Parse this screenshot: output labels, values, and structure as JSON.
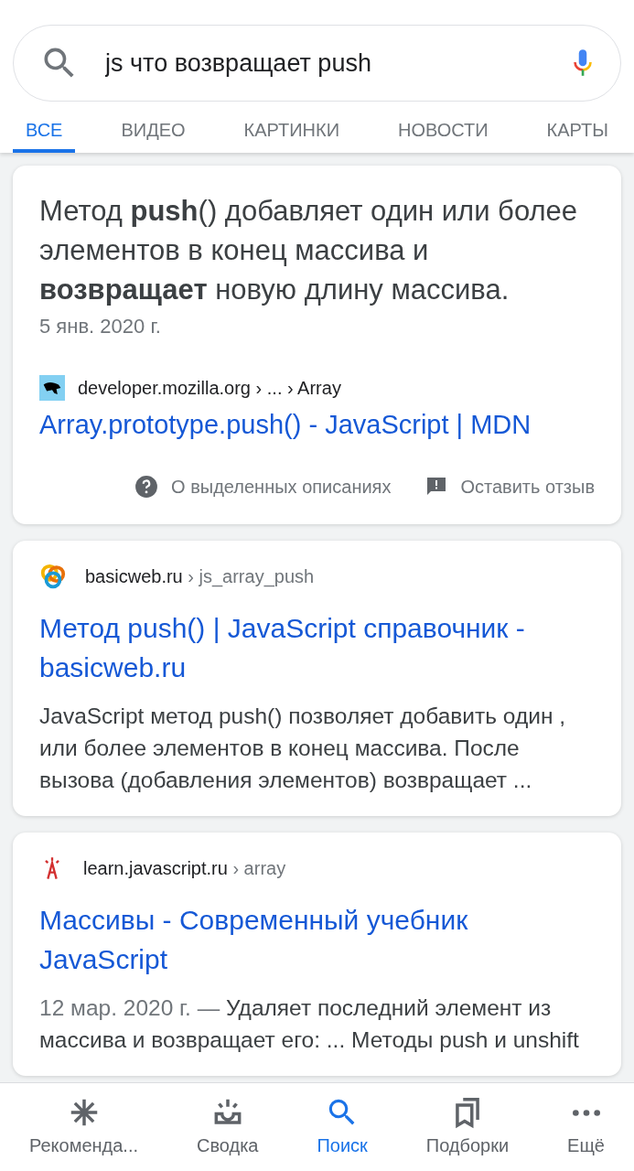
{
  "search": {
    "value": "js что возвращает push"
  },
  "tabs": [
    {
      "label": "ВСЕ",
      "selected": true
    },
    {
      "label": "ВИДЕО",
      "selected": false
    },
    {
      "label": "КАРТИНКИ",
      "selected": false
    },
    {
      "label": "НОВОСТИ",
      "selected": false
    },
    {
      "label": "КАРТЫ",
      "selected": false
    }
  ],
  "featured_snippet": {
    "text": "Метод **push**() добавляет один или более элементов в конец массива и **возвращает** новую длину массива.",
    "date": "5 янв. 2020 г.",
    "site": "developer.mozilla.org › ... › Array",
    "title": "Array.prototype.push() - JavaScript | MDN",
    "actions": [
      "О выделенных описаниях",
      "Оставить отзыв"
    ]
  },
  "results": [
    {
      "site": "basicweb.ru",
      "path": "› js_array_push",
      "title": "Метод push() | JavaScript справочник - basicweb.ru",
      "snippet": "JavaScript метод push() позволяет добавить один , или более элементов в конец массива. После вызова (добавления элементов) возвращает ..."
    },
    {
      "site": "learn.javascript.ru",
      "path": "› array",
      "title": "Массивы - Современный учебник JavaScript",
      "date": "12 мар. 2020 г. —",
      "snippet": "Удаляет последний элемент из массива и возвращает его: ... Методы push и unshift"
    }
  ],
  "bottom_nav": [
    {
      "label": "Рекоменда...",
      "selected": false
    },
    {
      "label": "Сводка",
      "selected": false
    },
    {
      "label": "Поиск",
      "selected": true
    },
    {
      "label": "Подборки",
      "selected": false
    },
    {
      "label": "Ещё",
      "selected": false
    }
  ]
}
